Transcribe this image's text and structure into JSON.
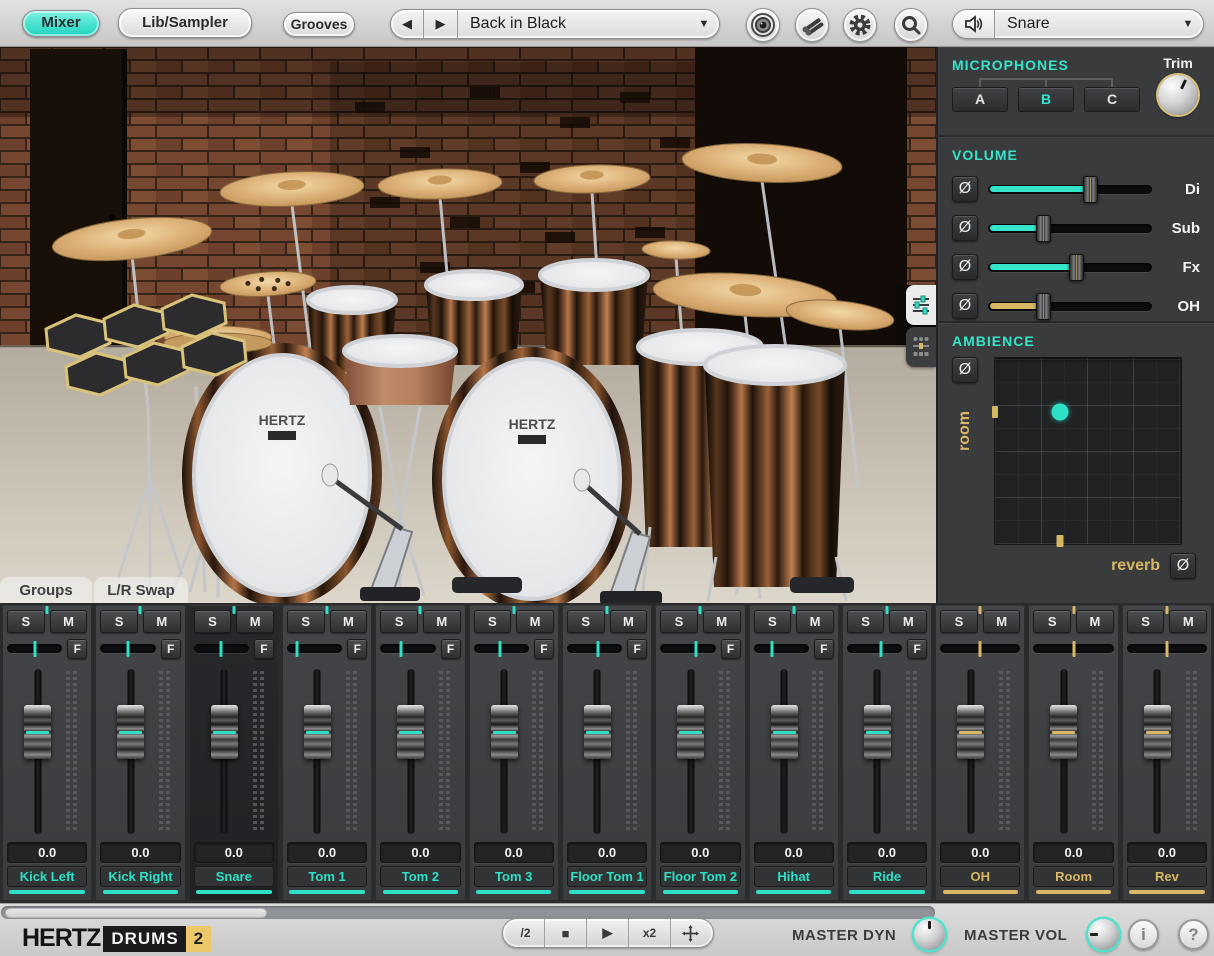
{
  "topbar": {
    "mixer_btn": "Mixer",
    "lib_sampler_btn": "Lib/Sampler",
    "grooves_btn": "Grooves",
    "preset_name": "Back in Black",
    "prev_glyph": "◀",
    "next_glyph": "▶",
    "dropdown_glyph": "▼",
    "instrument_name": "Snare"
  },
  "right_panel": {
    "phase_symbol": "Ø",
    "microphones": {
      "title": "MICROPHONES",
      "trim_label": "Trim",
      "mics": [
        {
          "label": "A",
          "selected": false
        },
        {
          "label": "B",
          "selected": true
        },
        {
          "label": "C",
          "selected": false
        }
      ]
    },
    "volume": {
      "title": "VOLUME",
      "sliders": [
        {
          "label": "Di",
          "value": 0.63,
          "color": "#35e5c9"
        },
        {
          "label": "Sub",
          "value": 0.34,
          "color": "#35e5c9"
        },
        {
          "label": "Fx",
          "value": 0.54,
          "color": "#35e5c9"
        },
        {
          "label": "OH",
          "value": 0.34,
          "color": "#d8b765"
        }
      ]
    },
    "ambience": {
      "title": "AMBIENCE",
      "x_label": "reverb",
      "y_label": "room",
      "dot_x": 0.35,
      "dot_y": 0.29
    }
  },
  "viewport": {
    "groups_tab": "Groups",
    "lr_swap_tab": "L/R Swap",
    "drum_badge": "HERTZ"
  },
  "mixer": {
    "solo_label": "S",
    "mute_label": "M",
    "fx_label": "F",
    "accent_teal": "#2ee0c6",
    "accent_gold": "#d8b765",
    "fader_pos": 0.32,
    "channels": [
      {
        "name": "Kick Left",
        "value": "0.0",
        "pan": 0,
        "accent": "teal",
        "has_f": true,
        "selected": false
      },
      {
        "name": "Kick Right",
        "value": "0.0",
        "pan": 0,
        "accent": "teal",
        "has_f": true,
        "selected": false
      },
      {
        "name": "Snare",
        "value": "0.0",
        "pan": 0,
        "accent": "teal",
        "has_f": true,
        "selected": true
      },
      {
        "name": "Tom 1",
        "value": "0.0",
        "pan": -0.75,
        "accent": "teal",
        "has_f": true,
        "selected": false
      },
      {
        "name": "Tom 2",
        "value": "0.0",
        "pan": -0.3,
        "accent": "teal",
        "has_f": true,
        "selected": false
      },
      {
        "name": "Tom 3",
        "value": "0.0",
        "pan": -0.05,
        "accent": "teal",
        "has_f": true,
        "selected": false
      },
      {
        "name": "Floor Tom 1",
        "value": "0.0",
        "pan": 0.15,
        "accent": "teal",
        "has_f": true,
        "selected": false
      },
      {
        "name": "Floor Tom 2",
        "value": "0.0",
        "pan": 0.35,
        "accent": "teal",
        "has_f": true,
        "selected": false
      },
      {
        "name": "Hihat",
        "value": "0.0",
        "pan": -0.4,
        "accent": "teal",
        "has_f": true,
        "selected": false
      },
      {
        "name": "Ride",
        "value": "0.0",
        "pan": 0.3,
        "accent": "teal",
        "has_f": true,
        "selected": false
      },
      {
        "name": "OH",
        "value": "0.0",
        "pan": 0,
        "accent": "gold",
        "has_f": false,
        "selected": false
      },
      {
        "name": "Room",
        "value": "0.0",
        "pan": 0,
        "accent": "gold",
        "has_f": false,
        "selected": false
      },
      {
        "name": "Rev",
        "value": "0.0",
        "pan": 0,
        "accent": "gold",
        "has_f": false,
        "selected": false
      }
    ]
  },
  "bottombar": {
    "logo_hertz": "HERTZ",
    "logo_drums": "DRUMS",
    "logo_2": "2",
    "transport": {
      "half": "/2",
      "stop": "■",
      "play": "▶",
      "double": "x2"
    },
    "master_dyn_label": "MASTER DYN",
    "master_vol_label": "MASTER VOL",
    "info_btn": "i",
    "help_btn": "?"
  }
}
